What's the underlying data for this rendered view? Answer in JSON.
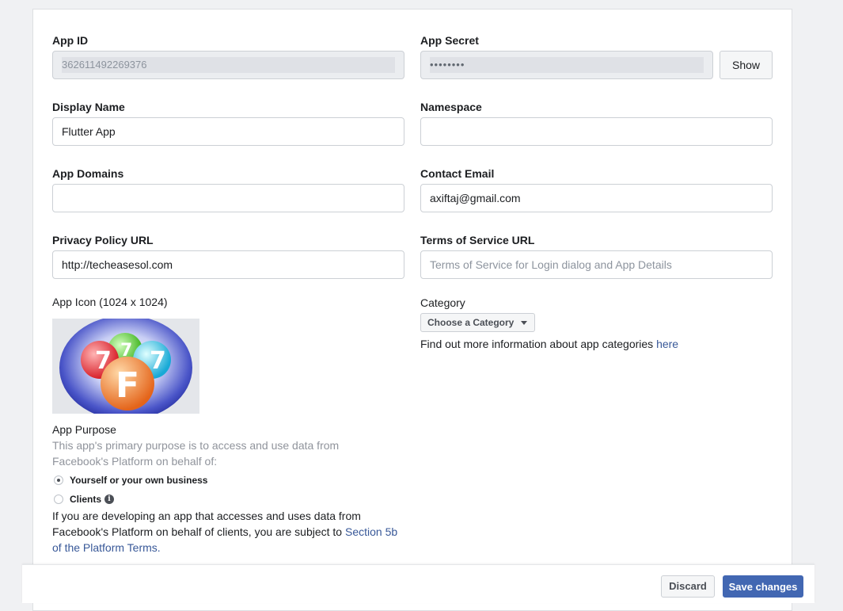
{
  "app_id": {
    "label": "App ID",
    "value": "362611492269376"
  },
  "app_secret": {
    "label": "App Secret",
    "value": "••••••••",
    "show_button": "Show"
  },
  "display_name": {
    "label": "Display Name",
    "value": "Flutter App"
  },
  "namespace": {
    "label": "Namespace",
    "value": ""
  },
  "app_domains": {
    "label": "App Domains",
    "value": ""
  },
  "contact_email": {
    "label": "Contact Email",
    "value": "axiftaj@gmail.com"
  },
  "privacy_policy": {
    "label": "Privacy Policy URL",
    "value": "http://techeasesol.com"
  },
  "terms_of_service": {
    "label": "Terms of Service URL",
    "placeholder": "Terms of Service for Login dialog and App Details"
  },
  "app_icon": {
    "label": "App Icon (1024 x 1024)",
    "icon_letter": "F",
    "ball_digit": "7"
  },
  "category": {
    "label": "Category",
    "selected": "Choose a Category",
    "info_text": "Find out more information about app categories ",
    "info_link": "here"
  },
  "app_purpose": {
    "label": "App Purpose",
    "description_line1": "This app's primary purpose is to access and use data from",
    "description_line2": "Facebook's Platform on behalf of:",
    "options": [
      {
        "label": "Yourself or your own business",
        "checked": true
      },
      {
        "label": "Clients",
        "checked": false
      }
    ],
    "note_line1": "If you are developing an app that accesses and uses data from",
    "note_line2": "Facebook's Platform on behalf of clients, you are subject to ",
    "note_link1": "Section 5b",
    "note_link2": "of the Platform Terms."
  },
  "footer": {
    "discard": "Discard",
    "save": "Save changes"
  },
  "colors": {
    "accent": "#4267b2",
    "link": "#385898",
    "border": "#ccd0d5"
  }
}
